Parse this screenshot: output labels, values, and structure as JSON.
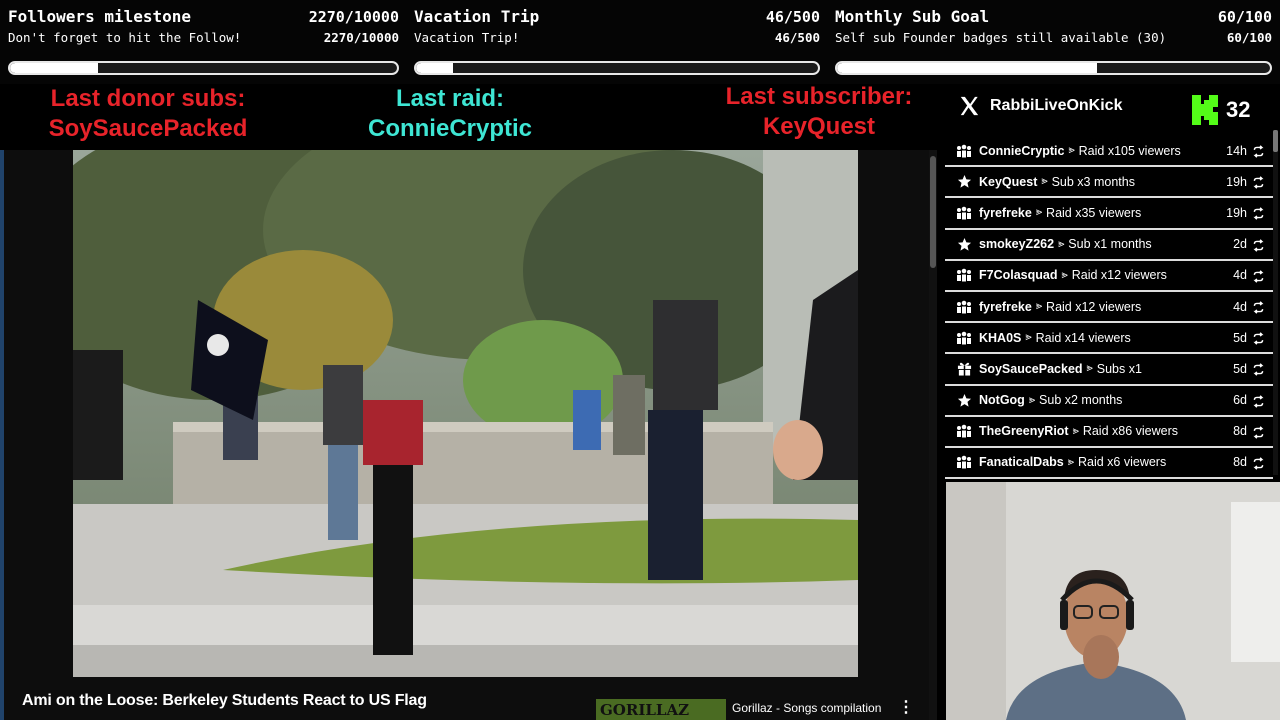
{
  "goals": [
    {
      "title": "Followers milestone",
      "count": "2270/10000",
      "subtitle": "Don't forget to hit the Follow!",
      "sub_count": "2270/10000",
      "progress": 0.227
    },
    {
      "title": "Vacation Trip",
      "count": "46/500",
      "subtitle": "Vacation Trip!",
      "sub_count": "46/500",
      "progress": 0.092
    },
    {
      "title": "Monthly Sub Goal",
      "count": "60/100",
      "subtitle": "Self sub Founder badges still available (30)",
      "sub_count": "60/100",
      "progress": 0.6
    }
  ],
  "last_events": {
    "donor_label": "Last donor subs:",
    "donor_name": "SoySaucePacked",
    "raid_label": "Last raid:",
    "raid_name": "ConnieCryptic",
    "subscriber_label": "Last subscriber:",
    "subscriber_name": "KeyQuest"
  },
  "social": {
    "handle": "RabbiLiveOnKick",
    "icon": "x-logo-icon"
  },
  "kick": {
    "count": "32",
    "icon": "kick-logo-icon"
  },
  "colors": {
    "accent_red": "#e8232a",
    "accent_teal": "#3ee6d4",
    "kick_green": "#53fc18"
  },
  "events": [
    {
      "type": "raid",
      "icon": "raid-icon",
      "name": "ConnieCryptic",
      "sep": "⪢",
      "desc": "Raid x105 viewers",
      "time": "14h"
    },
    {
      "type": "sub",
      "icon": "star-icon",
      "name": "KeyQuest",
      "sep": "⪢",
      "desc": "Sub x3 months",
      "time": "19h"
    },
    {
      "type": "raid",
      "icon": "raid-icon",
      "name": "fyrefreke",
      "sep": "⪢",
      "desc": "Raid x35 viewers",
      "time": "19h"
    },
    {
      "type": "sub",
      "icon": "star-icon",
      "name": "smokeyZ262",
      "sep": "⪢",
      "desc": "Sub x1 months",
      "time": "2d"
    },
    {
      "type": "raid",
      "icon": "raid-icon",
      "name": "F7Colasquad",
      "sep": "⪢",
      "desc": "Raid x12 viewers",
      "time": "4d"
    },
    {
      "type": "raid",
      "icon": "raid-icon",
      "name": "fyrefreke",
      "sep": "⪢",
      "desc": "Raid x12 viewers",
      "time": "4d"
    },
    {
      "type": "raid",
      "icon": "raid-icon",
      "name": "KHA0S",
      "sep": "⪢",
      "desc": "Raid x14 viewers",
      "time": "5d"
    },
    {
      "type": "gift",
      "icon": "gift-icon",
      "name": "SoySaucePacked",
      "sep": "⪢",
      "desc": "Subs x1",
      "time": "5d"
    },
    {
      "type": "sub",
      "icon": "star-icon",
      "name": "NotGog",
      "sep": "⪢",
      "desc": "Sub x2 months",
      "time": "6d"
    },
    {
      "type": "raid",
      "icon": "raid-icon",
      "name": "TheGreenyRiot",
      "sep": "⪢",
      "desc": "Raid x86 viewers",
      "time": "8d"
    },
    {
      "type": "raid",
      "icon": "raid-icon",
      "name": "FanaticalDabs",
      "sep": "⪢",
      "desc": "Raid x6 viewers",
      "time": "8d"
    }
  ],
  "video": {
    "title": "Ami on the Loose: Berkeley Students React to US Flag",
    "recommended_title": "Gorillaz - Songs compilation",
    "recommended_thumb_text": "GORILLAZ",
    "menu_glyph": "⋮"
  }
}
